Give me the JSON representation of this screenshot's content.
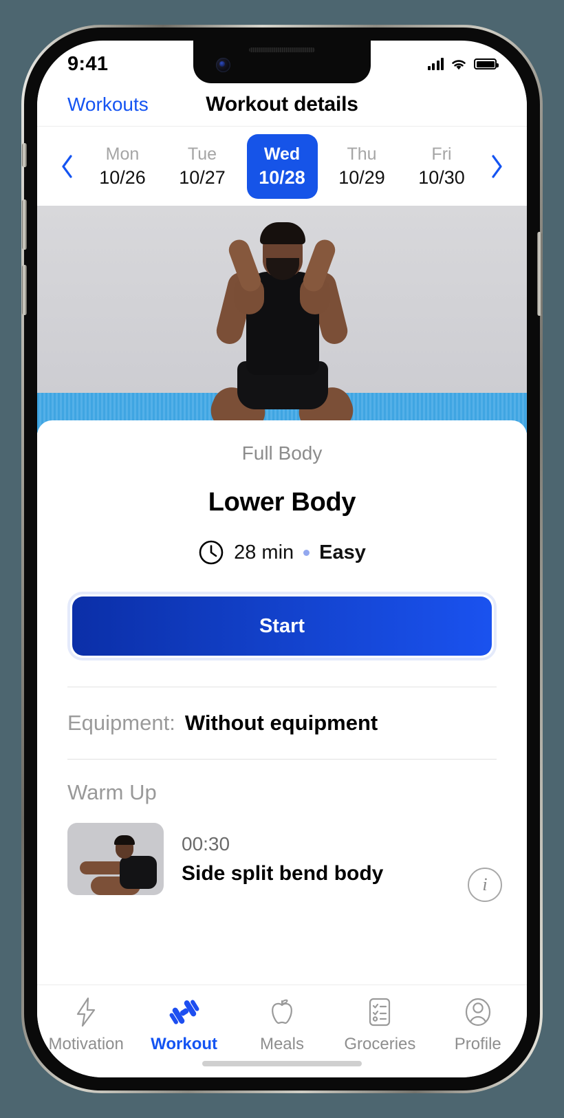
{
  "status_bar": {
    "time": "9:41",
    "cellular_icon": "signal-bars-icon",
    "wifi_icon": "wifi-icon",
    "battery_icon": "battery-icon"
  },
  "nav": {
    "back_label": "Workouts",
    "title": "Workout details",
    "back_icon": "chevron-left-icon"
  },
  "date_strip": {
    "prev_icon": "chevron-left-icon",
    "next_icon": "chevron-right-icon",
    "days": [
      {
        "dow": "Mon",
        "date": "10/26",
        "selected": false
      },
      {
        "dow": "Tue",
        "date": "10/27",
        "selected": false
      },
      {
        "dow": "Wed",
        "date": "10/28",
        "selected": true
      },
      {
        "dow": "Thu",
        "date": "10/29",
        "selected": false
      },
      {
        "dow": "Fri",
        "date": "10/30",
        "selected": false
      }
    ]
  },
  "workout": {
    "category": "Full Body",
    "title": "Lower Body",
    "duration": "28 min",
    "separator": "•",
    "difficulty": "Easy",
    "clock_icon": "clock-icon",
    "start_label": "Start",
    "equipment_label": "Equipment:",
    "equipment_value": "Without equipment"
  },
  "sections": [
    {
      "title": "Warm Up",
      "exercises": [
        {
          "duration": "00:30",
          "name": "Side split bend body",
          "info_icon": "info-icon"
        }
      ]
    }
  ],
  "tabbar": {
    "items": [
      {
        "label": "Motivation",
        "icon": "lightning-bolt-icon",
        "active": false
      },
      {
        "label": "Workout",
        "icon": "dumbbell-icon",
        "active": true
      },
      {
        "label": "Meals",
        "icon": "apple-icon",
        "active": false
      },
      {
        "label": "Groceries",
        "icon": "checklist-icon",
        "active": false
      },
      {
        "label": "Profile",
        "icon": "person-icon",
        "active": false
      }
    ]
  },
  "colors": {
    "accent": "#1454f2",
    "accent_selected": "#1654e8",
    "page_background": "#4d6670",
    "muted_text": "#8e8e8e"
  }
}
